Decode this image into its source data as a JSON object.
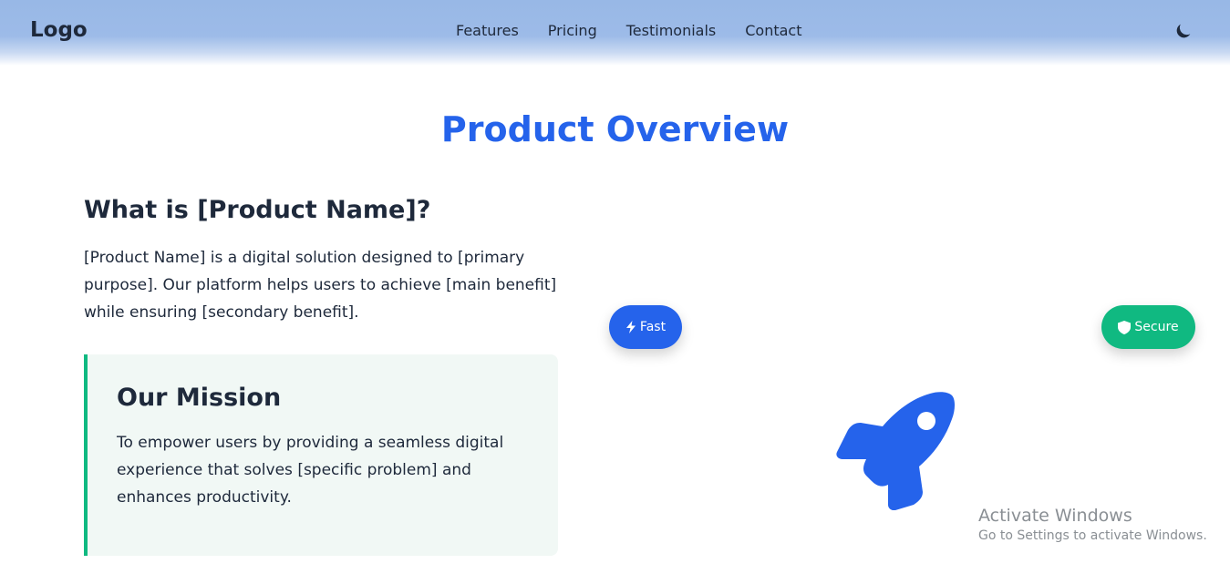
{
  "nav": {
    "logo": "Logo",
    "links": [
      "Features",
      "Pricing",
      "Testimonials",
      "Contact"
    ],
    "theme_icon": "moon-icon"
  },
  "overview": {
    "title": "Product Overview",
    "what_heading": "What is [Product Name]?",
    "what_text": "[Product Name] is a digital solution designed to [primary purpose]. Our platform helps users to achieve [main benefit] while ensuring [secondary benefit].",
    "mission_heading": "Our Mission",
    "mission_text": "To empower users by providing a seamless digital experience that solves [specific problem] and enhances productivity."
  },
  "badges": {
    "fast": {
      "label": "Fast",
      "icon": "bolt-icon",
      "color": "#2563eb"
    },
    "secure": {
      "label": "Secure",
      "icon": "shield-icon",
      "color": "#10b981"
    }
  },
  "hero_icon": "rocket-icon",
  "colors": {
    "accent": "#2563eb",
    "success": "#10b981",
    "text": "#1e293b"
  },
  "watermark": {
    "title": "Activate Windows",
    "subtitle": "Go to Settings to activate Windows."
  }
}
